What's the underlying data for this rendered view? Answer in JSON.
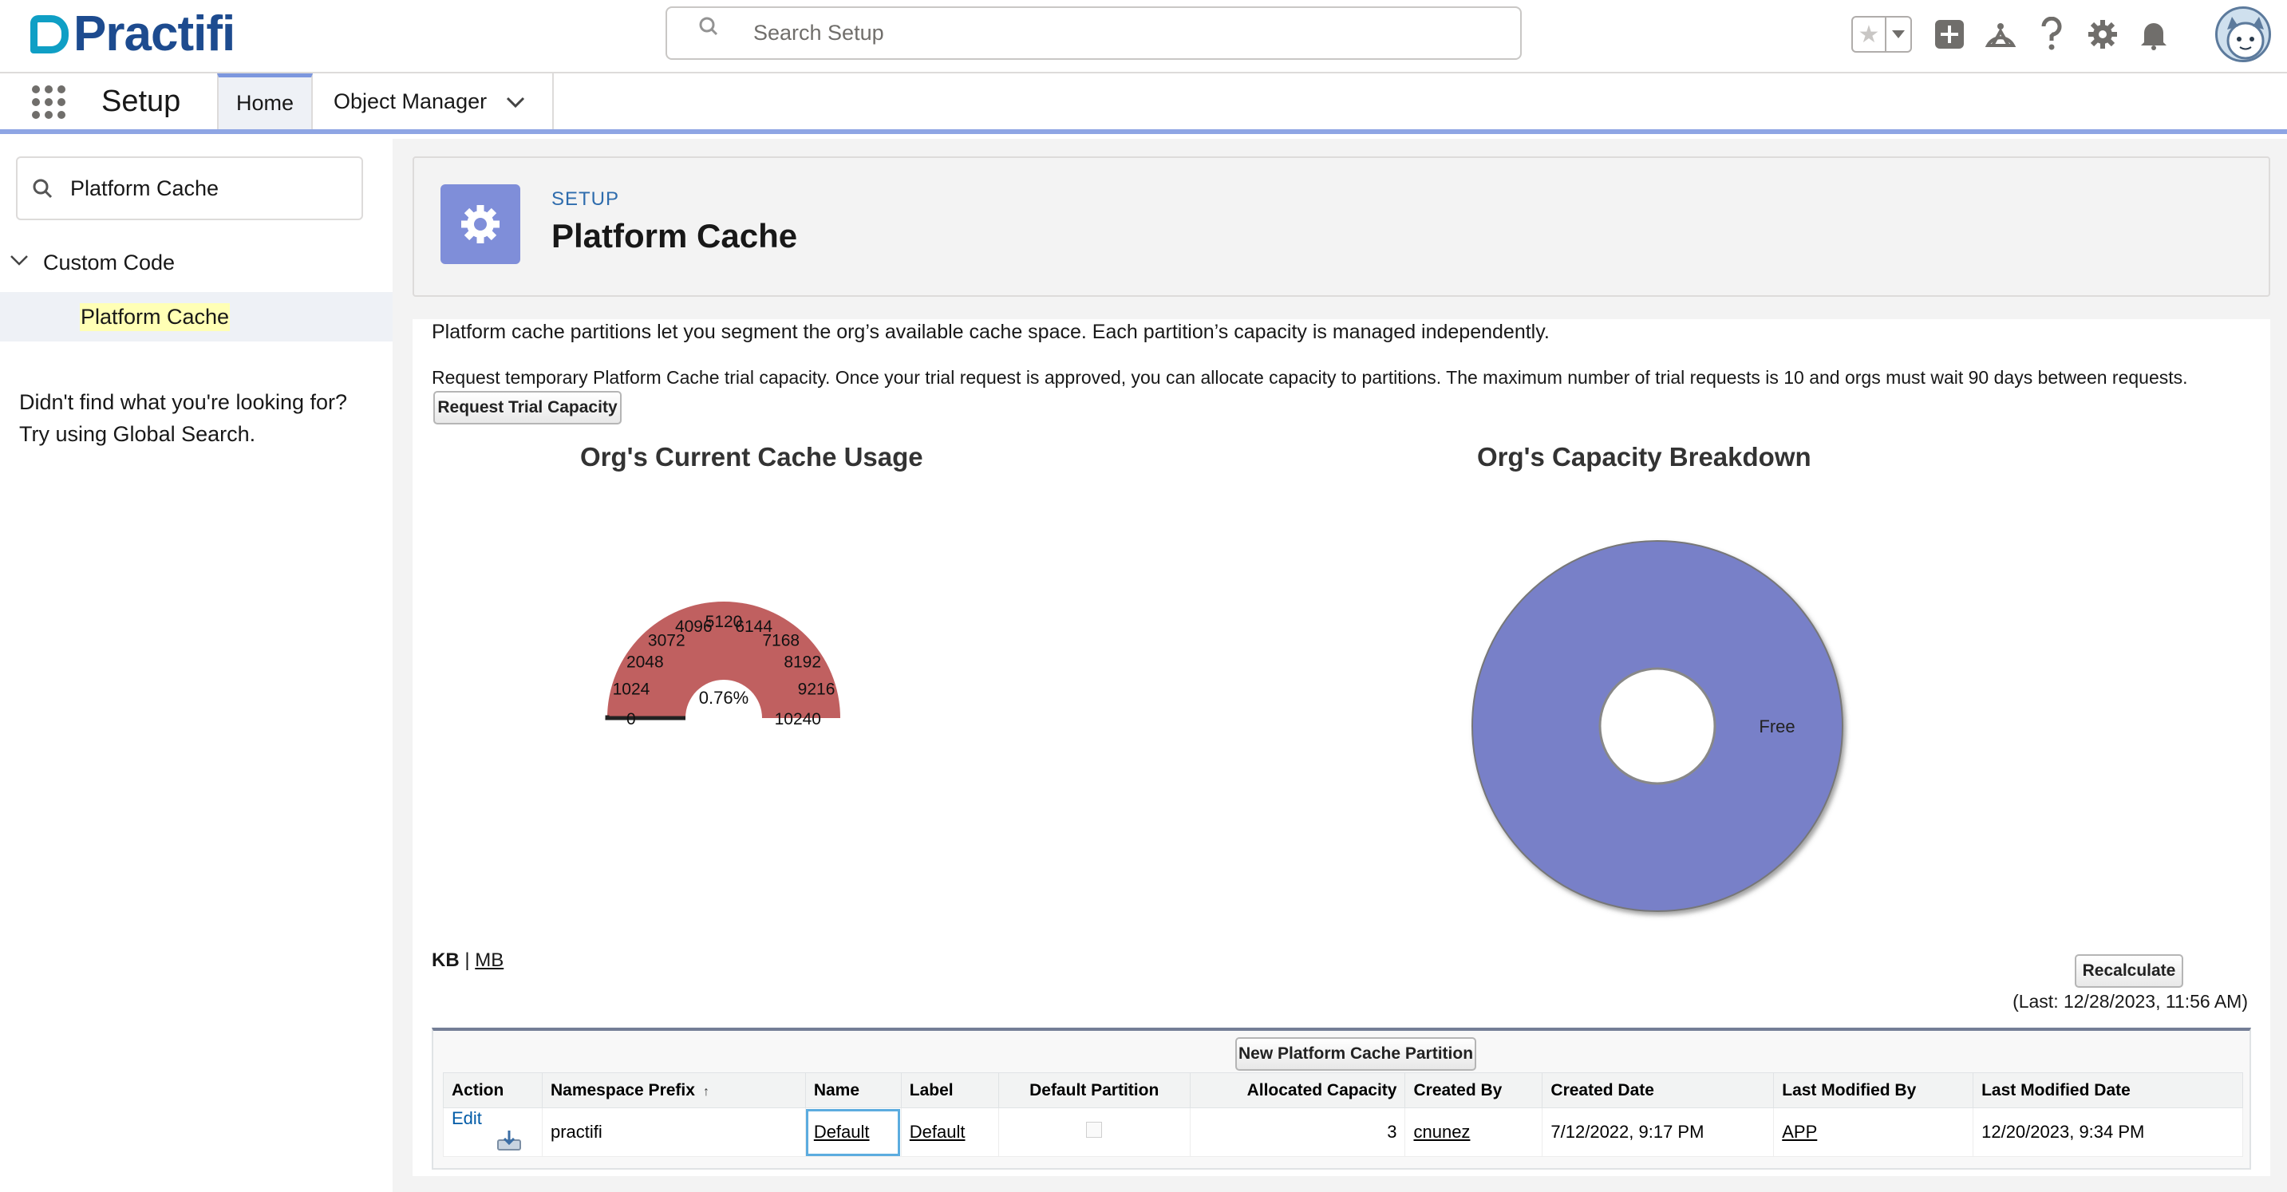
{
  "header": {
    "brand": "Practifi",
    "search_placeholder": "Search Setup",
    "icons": [
      "star-icon",
      "chevron-down-icon",
      "plus-icon",
      "trailhead-icon",
      "help-icon",
      "gear-icon",
      "bell-icon",
      "avatar"
    ]
  },
  "context": {
    "app_name": "Setup",
    "tabs": [
      {
        "label": "Home",
        "active": true
      },
      {
        "label": "Object Manager",
        "active": false
      }
    ]
  },
  "sidebar": {
    "quick_find_value": "Platform Cache",
    "group_label": "Custom Code",
    "item_label": "Platform Cache",
    "help_line1": "Didn't find what you're looking for?",
    "help_line2": "Try using Global Search."
  },
  "page": {
    "breadcrumb": "SETUP",
    "title": "Platform Cache",
    "intro": "Platform cache partitions let you segment the org’s available cache space. Each partition’s capacity is managed independently.",
    "trial_text": "Request temporary Platform Cache trial capacity. Once your trial request is approved, you can allocate capacity to partitions. The maximum number of trial requests is 10 and orgs must wait 90 days between requests.",
    "trial_button": "Request Trial Capacity",
    "units_kb": "KB",
    "units_sep": "|",
    "units_mb": "MB",
    "recalc_button": "Recalculate",
    "last_calc": "(Last: 12/28/2023, 11:56 AM)",
    "new_partition_button": "New Platform Cache Partition"
  },
  "chart_data": [
    {
      "type": "gauge",
      "title": "Org's Current Cache Usage",
      "ticks": [
        "0",
        "1024",
        "2048",
        "3072",
        "4096",
        "5120",
        "6144",
        "7168",
        "8192",
        "9216",
        "10240"
      ],
      "range": [
        0,
        10240
      ],
      "value_percent": 0.76,
      "value_label": "0.76%",
      "color": "#c06060"
    },
    {
      "type": "pie",
      "title": "Org's Capacity Breakdown",
      "slices": [
        {
          "label": "Free",
          "value": 100,
          "color": "#7880c8"
        }
      ]
    }
  ],
  "table": {
    "columns": [
      "Action",
      "Namespace Prefix",
      "Name",
      "Label",
      "Default Partition",
      "Allocated Capacity",
      "Created By",
      "Created Date",
      "Last Modified By",
      "Last Modified Date"
    ],
    "rows": [
      {
        "action": "Edit",
        "namespace": "practifi",
        "name": "Default",
        "label": "Default",
        "default_partition": false,
        "allocated": "3",
        "created_by": "cnunez",
        "created_date": "7/12/2022, 9:17 PM",
        "modified_by": "APP",
        "modified_date": "12/20/2023, 9:34 PM"
      }
    ]
  }
}
